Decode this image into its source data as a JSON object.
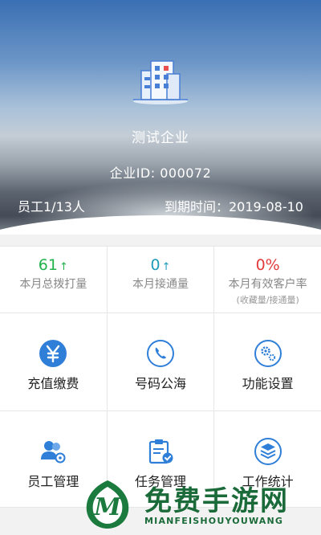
{
  "header": {
    "company_name": "测试企业",
    "company_id": "企业ID: 000072",
    "employee_count": "员工1/13人",
    "expiry": "到期时间：2019-08-10"
  },
  "stats": [
    {
      "value": "61",
      "arrow": "↑",
      "label": "本月总拨打量",
      "color": "#22b14c"
    },
    {
      "value": "0",
      "arrow": "↑",
      "label": "本月接通量",
      "color": "#1e9bb8"
    },
    {
      "value": "0%",
      "label": "本月有效客户率",
      "sub": "(收藏量/接通量)",
      "color": "#e23b3b"
    }
  ],
  "functions": [
    {
      "label": "充值缴费",
      "icon": "yen-icon"
    },
    {
      "label": "号码公海",
      "icon": "phone-icon"
    },
    {
      "label": "功能设置",
      "icon": "gear-icon"
    },
    {
      "label": "员工管理",
      "icon": "users-icon"
    },
    {
      "label": "任务管理",
      "icon": "task-icon"
    },
    {
      "label": "工作统计",
      "icon": "layers-icon"
    }
  ],
  "watermark": {
    "title": "免费手游网",
    "subtitle": "MIANFEISHOUYOUWANG"
  }
}
